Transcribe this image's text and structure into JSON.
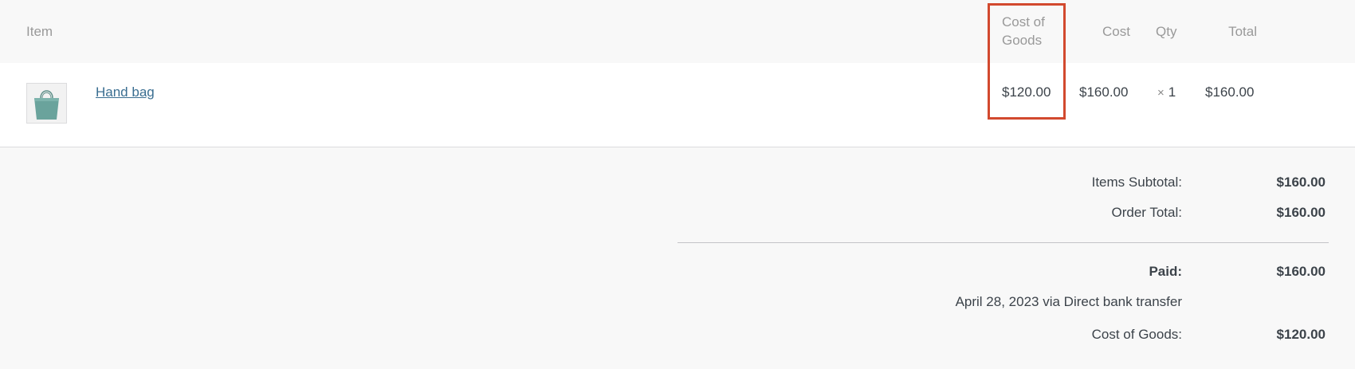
{
  "columns": {
    "item": "Item",
    "cost_of_goods": "Cost of Goods",
    "cost": "Cost",
    "qty": "Qty",
    "total": "Total"
  },
  "line_item": {
    "name": "Hand bag",
    "thumbnail_icon": "handbag-icon",
    "cost_of_goods": "$120.00",
    "cost": "$160.00",
    "qty_prefix": "×",
    "qty": "1",
    "total": "$160.00"
  },
  "totals": {
    "items_subtotal_label": "Items Subtotal:",
    "items_subtotal_value": "$160.00",
    "order_total_label": "Order Total:",
    "order_total_value": "$160.00",
    "paid_label": "Paid:",
    "paid_value": "$160.00",
    "payment_note": "April 28, 2023 via Direct bank transfer",
    "cost_of_goods_label": "Cost of Goods:",
    "cost_of_goods_value": "$120.00"
  },
  "colors": {
    "highlight": "#d2492e",
    "link": "#3a6e91",
    "handbag": "#6aa39c"
  }
}
